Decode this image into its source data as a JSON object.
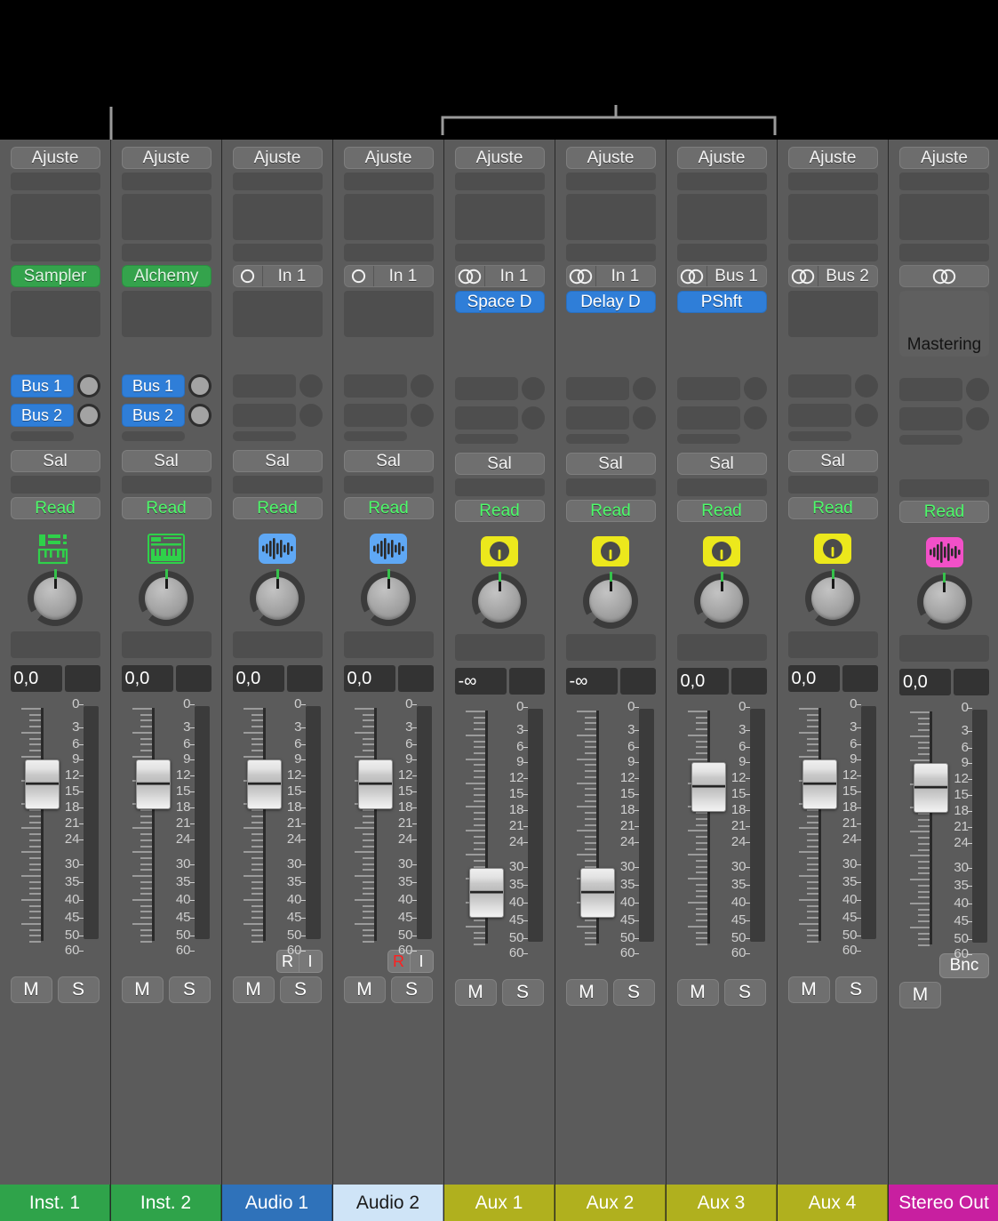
{
  "annotations": {
    "pointer_line": {
      "label": "send-pointer-line"
    },
    "group_bracket": {
      "label": "aux-group-bracket"
    }
  },
  "colors": {
    "instrument": "#2fa34a",
    "audio": "#2f72ba",
    "audio_selected": "#cfe4f7",
    "aux": "#b0b01e",
    "stereo_out": "#c81fa0",
    "send_assigned": "#2f7ed8",
    "plugin": "#2f7ed8",
    "automation_read": "#4dfa6a",
    "record_armed": "#ff1f1f",
    "pan_led": "#35c24b"
  },
  "fader_scale": {
    "ticks": [
      "0",
      "3",
      "6",
      "9",
      "12",
      "15",
      "18",
      "21",
      "24",
      "30",
      "35",
      "40",
      "45",
      "50",
      "60"
    ]
  },
  "labels": {
    "setting": "Ajuste",
    "send_out": "Sal",
    "automation": "Read",
    "mute": "M",
    "solo": "S",
    "record": "R",
    "input_monitor": "I",
    "bounce": "Bnc",
    "mastering": "Mastering",
    "mono_icon": "mono",
    "stereo_icon": "stereo"
  },
  "strips": [
    {
      "name": "Inst. 1",
      "type": "instrument",
      "nameplate_color": "#2fa34a",
      "nameplate_text_color": "#ffffff",
      "setting": "Ajuste",
      "instrument_slot": "Sampler",
      "io": null,
      "plugin": null,
      "mastering": null,
      "icon": "sampler-icon",
      "icon_color": "#2fd14a",
      "sends": [
        {
          "label": "Bus 1",
          "assigned": true,
          "knob": "active"
        },
        {
          "label": "Bus 2",
          "assigned": true,
          "knob": "active"
        }
      ],
      "output": "Sal",
      "automation": "Read",
      "gain": "0,0",
      "fader_pos": 0.28,
      "has_ri": false,
      "record_armed": false,
      "has_bnc": false,
      "mute": "M",
      "solo": "S"
    },
    {
      "name": "Inst. 2",
      "type": "instrument",
      "nameplate_color": "#2fa34a",
      "nameplate_text_color": "#ffffff",
      "setting": "Ajuste",
      "instrument_slot": "Alchemy",
      "io": null,
      "plugin": null,
      "mastering": null,
      "icon": "synth-keyboard-icon",
      "icon_color": "#2fd14a",
      "sends": [
        {
          "label": "Bus 1",
          "assigned": true,
          "knob": "active"
        },
        {
          "label": "Bus 2",
          "assigned": true,
          "knob": "active"
        }
      ],
      "output": "Sal",
      "automation": "Read",
      "gain": "0,0",
      "fader_pos": 0.28,
      "has_ri": false,
      "record_armed": false,
      "has_bnc": false,
      "mute": "M",
      "solo": "S"
    },
    {
      "name": "Audio 1",
      "type": "audio",
      "nameplate_color": "#2f72ba",
      "nameplate_text_color": "#ffffff",
      "setting": "Ajuste",
      "instrument_slot": null,
      "io": {
        "format": "mono",
        "source": "In 1"
      },
      "plugin": null,
      "mastering": null,
      "icon": "waveform-icon",
      "icon_color": "#5fa8f5",
      "sends": [
        {
          "label": "",
          "assigned": false,
          "knob": "idle"
        },
        {
          "label": "",
          "assigned": false,
          "knob": "idle"
        }
      ],
      "output": "Sal",
      "automation": "Read",
      "gain": "0,0",
      "fader_pos": 0.28,
      "has_ri": true,
      "record_armed": false,
      "has_bnc": false,
      "mute": "M",
      "solo": "S"
    },
    {
      "name": "Audio 2",
      "type": "audio",
      "nameplate_color": "#cfe4f7",
      "nameplate_text_color": "#1a1a1a",
      "setting": "Ajuste",
      "instrument_slot": null,
      "io": {
        "format": "mono",
        "source": "In 1"
      },
      "plugin": null,
      "mastering": null,
      "icon": "waveform-icon",
      "icon_color": "#5fa8f5",
      "sends": [
        {
          "label": "",
          "assigned": false,
          "knob": "idle"
        },
        {
          "label": "",
          "assigned": false,
          "knob": "idle"
        }
      ],
      "output": "Sal",
      "automation": "Read",
      "gain": "0,0",
      "fader_pos": 0.28,
      "has_ri": true,
      "record_armed": true,
      "has_bnc": false,
      "mute": "M",
      "solo": "S"
    },
    {
      "name": "Aux 1",
      "type": "aux",
      "nameplate_color": "#b0b01e",
      "nameplate_text_color": "#ffffff",
      "setting": "Ajuste",
      "instrument_slot": null,
      "io": {
        "format": "stereo",
        "source": "In 1"
      },
      "plugin": "Space D",
      "mastering": null,
      "icon": "aux-knob-icon",
      "icon_color": "#ece81c",
      "sends": [
        {
          "label": "",
          "assigned": false,
          "knob": "idle"
        },
        {
          "label": "",
          "assigned": false,
          "knob": "idle"
        }
      ],
      "output": "Sal",
      "automation": "Read",
      "gain": "-∞",
      "fader_pos": 0.86,
      "has_ri": false,
      "record_armed": false,
      "has_bnc": false,
      "mute": "M",
      "solo": "S"
    },
    {
      "name": "Aux 2",
      "type": "aux",
      "nameplate_color": "#b0b01e",
      "nameplate_text_color": "#ffffff",
      "setting": "Ajuste",
      "instrument_slot": null,
      "io": {
        "format": "stereo",
        "source": "In 1"
      },
      "plugin": "Delay D",
      "mastering": null,
      "icon": "aux-knob-icon",
      "icon_color": "#ece81c",
      "sends": [
        {
          "label": "",
          "assigned": false,
          "knob": "idle"
        },
        {
          "label": "",
          "assigned": false,
          "knob": "idle"
        }
      ],
      "output": "Sal",
      "automation": "Read",
      "gain": "-∞",
      "fader_pos": 0.86,
      "has_ri": false,
      "record_armed": false,
      "has_bnc": false,
      "mute": "M",
      "solo": "S"
    },
    {
      "name": "Aux 3",
      "type": "aux",
      "nameplate_color": "#b0b01e",
      "nameplate_text_color": "#ffffff",
      "setting": "Ajuste",
      "instrument_slot": null,
      "io": {
        "format": "stereo",
        "source": "Bus 1"
      },
      "plugin": "PShft",
      "mastering": null,
      "icon": "aux-knob-icon",
      "icon_color": "#ece81c",
      "sends": [
        {
          "label": "",
          "assigned": false,
          "knob": "idle"
        },
        {
          "label": "",
          "assigned": false,
          "knob": "idle"
        }
      ],
      "output": "Sal",
      "automation": "Read",
      "gain": "0,0",
      "fader_pos": 0.28,
      "has_ri": false,
      "record_armed": false,
      "has_bnc": false,
      "mute": "M",
      "solo": "S"
    },
    {
      "name": "Aux 4",
      "type": "aux",
      "nameplate_color": "#b0b01e",
      "nameplate_text_color": "#ffffff",
      "setting": "Ajuste",
      "instrument_slot": null,
      "io": {
        "format": "stereo",
        "source": "Bus 2"
      },
      "plugin": null,
      "mastering": null,
      "icon": "aux-knob-icon",
      "icon_color": "#ece81c",
      "sends": [
        {
          "label": "",
          "assigned": false,
          "knob": "idle"
        },
        {
          "label": "",
          "assigned": false,
          "knob": "idle"
        }
      ],
      "output": "Sal",
      "automation": "Read",
      "gain": "0,0",
      "fader_pos": 0.28,
      "has_ri": false,
      "record_armed": false,
      "has_bnc": false,
      "mute": "M",
      "solo": "S"
    },
    {
      "name": "Stereo Out",
      "type": "output",
      "nameplate_color": "#c81fa0",
      "nameplate_text_color": "#ffffff",
      "setting": "Ajuste",
      "instrument_slot": null,
      "io": {
        "format": "stereo",
        "source": ""
      },
      "plugin": null,
      "mastering": "Mastering",
      "icon": "waveform-icon",
      "icon_color": "#f250c8",
      "sends": [
        {
          "label": "",
          "assigned": false,
          "knob": "idle"
        },
        {
          "label": "",
          "assigned": false,
          "knob": "idle"
        }
      ],
      "output": null,
      "automation": "Read",
      "gain": "0,0",
      "fader_pos": 0.28,
      "has_ri": false,
      "record_armed": false,
      "has_bnc": true,
      "mute": "M",
      "solo": null
    }
  ]
}
